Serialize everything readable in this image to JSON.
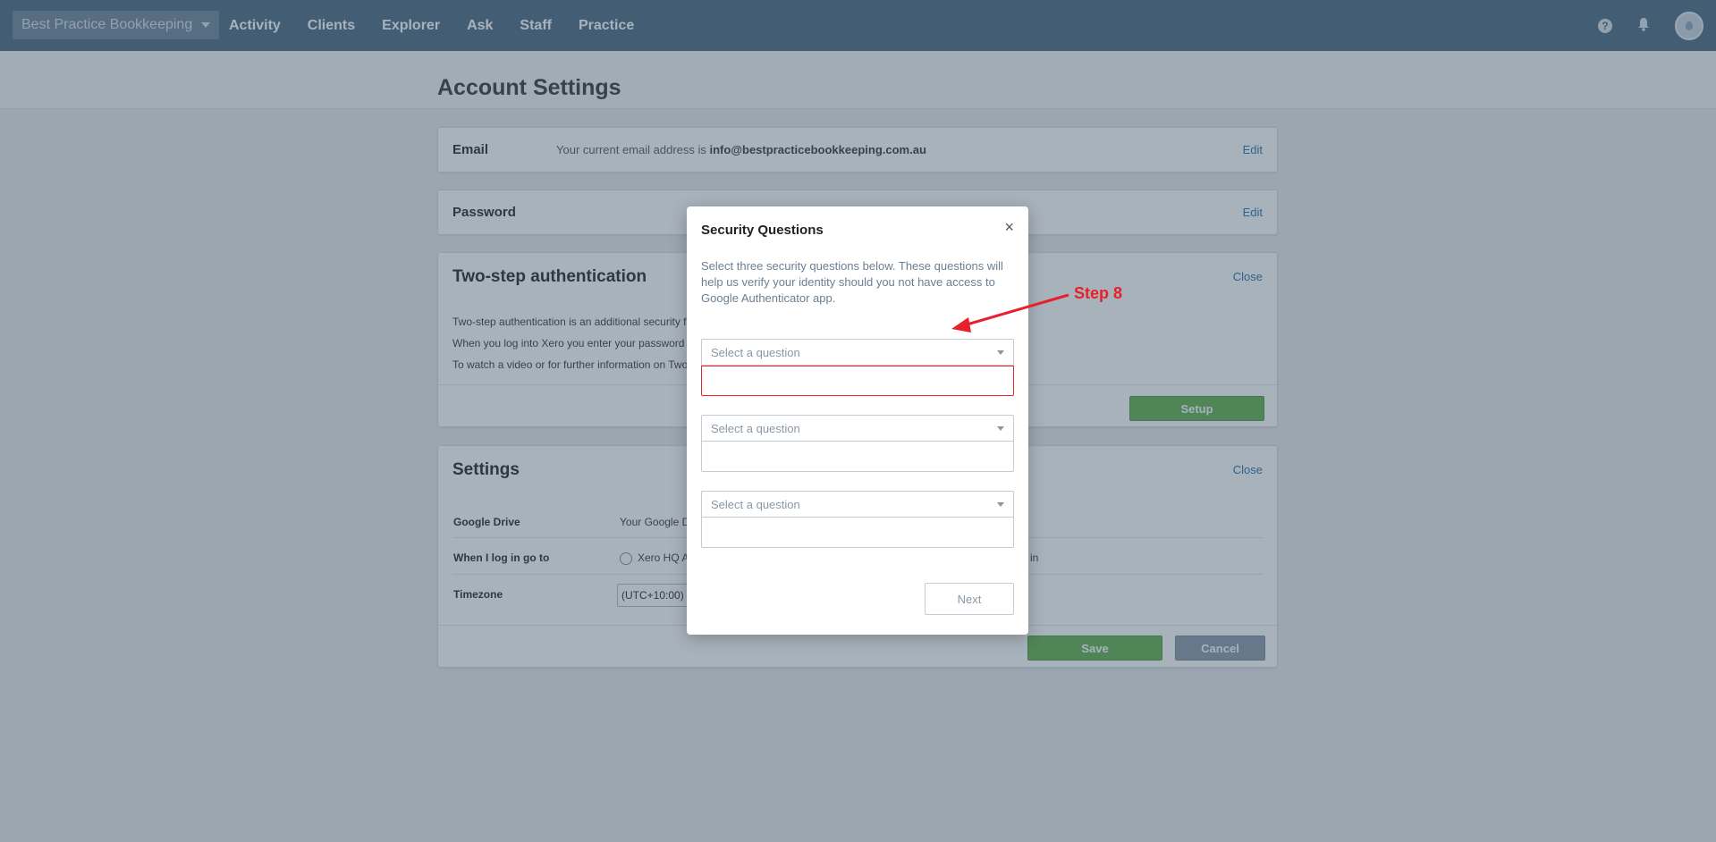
{
  "topnav": {
    "org_name": "Best Practice Bookkeeping",
    "links": [
      "Activity",
      "Clients",
      "Explorer",
      "Ask",
      "Staff",
      "Practice"
    ],
    "help_glyph": "?"
  },
  "page": {
    "title": "Account Settings"
  },
  "email": {
    "label": "Email",
    "text_prefix": "Your current email address is ",
    "address": "info@bestpracticebookkeeping.com.au",
    "edit": "Edit"
  },
  "password": {
    "label": "Password",
    "edit": "Edit"
  },
  "twostep": {
    "title": "Two-step authentication",
    "close": "Close",
    "lines": [
      "Two-step authentication is an additional security fe",
      "When you log into Xero you enter your password",
      "To watch a video or for further information on Two"
    ],
    "setup": "Setup"
  },
  "settings": {
    "title": "Settings",
    "close": "Close",
    "google_drive_label": "Google Drive",
    "google_drive_value": "Your Google D",
    "login_label": "When I log in go to",
    "login_option": "Xero HQ A",
    "login_option_tail": "in",
    "timezone_label": "Timezone",
    "timezone_value": "(UTC+10:00)",
    "save": "Save",
    "cancel": "Cancel"
  },
  "modal": {
    "title": "Security Questions",
    "close_glyph": "×",
    "description": "Select three security questions below. These questions will help us verify your identity should you not have access to Google Authenticator app.",
    "questions": [
      {
        "placeholder": "Select a question"
      },
      {
        "placeholder": "Select a question"
      },
      {
        "placeholder": "Select a question"
      }
    ],
    "next": "Next"
  },
  "annotation": {
    "label": "Step 8",
    "color": "#e8202b"
  }
}
